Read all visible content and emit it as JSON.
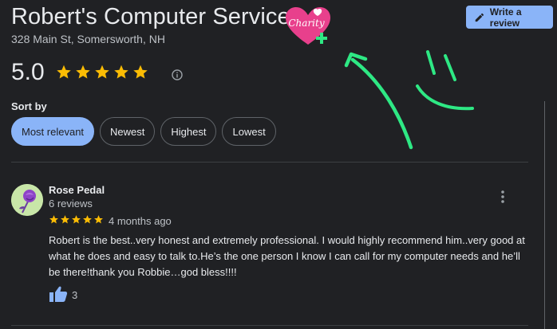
{
  "business": {
    "name": "Robert's Computer Service",
    "address": "328 Main St, Somersworth, NH",
    "rating": "5.0",
    "stars": 5
  },
  "badge": {
    "text": "Charity",
    "icon": "heart-charity-icon"
  },
  "toolbar": {
    "write_review_label": "Write a review",
    "write_review_icon": "pencil-icon"
  },
  "sort": {
    "label": "Sort by",
    "options": [
      "Most relevant",
      "Newest",
      "Highest",
      "Lowest"
    ],
    "selected": "Most relevant"
  },
  "review": {
    "author": "Rose Pedal",
    "author_meta": "6 reviews",
    "stars": 5,
    "date": "4 months ago",
    "text": "Robert is the best..very honest and extremely professional. I would highly recommend him..very good at what he does and easy to talk to.He’s the one person I know I can call for my computer needs and he’ll be there!thank you Robbie…god bless!!!!",
    "likes": "3"
  },
  "colors": {
    "background": "#202124",
    "accent": "#8ab4f8",
    "star": "#fbbc04",
    "annotation": "#2ee884",
    "badge_pink": "#e8408c"
  }
}
